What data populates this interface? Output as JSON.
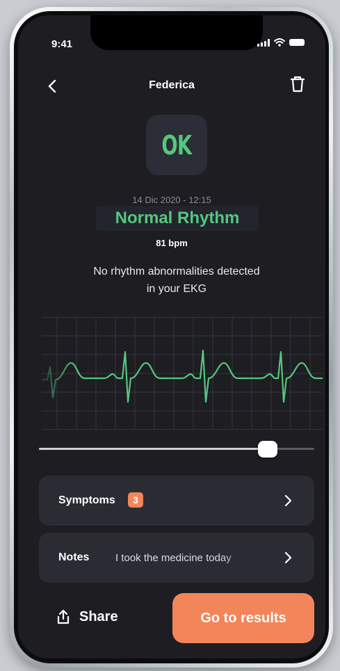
{
  "status_bar": {
    "time": "9:41"
  },
  "nav": {
    "title": "Federica",
    "back_icon": "chevron-left-icon",
    "delete_icon": "trash-icon"
  },
  "result": {
    "badge": "OK",
    "datetime": "14 Dic 2020 - 12:15",
    "rhythm": "Normal Rhythm",
    "bpm": "81 bpm",
    "message": "No rhythm abnormalities detected in your EKG"
  },
  "playback": {
    "position_fraction": 0.83
  },
  "cards": {
    "symptoms": {
      "label": "Symptoms",
      "count": "3"
    },
    "notes": {
      "label": "Notes",
      "text": "I took the medicine today"
    }
  },
  "actions": {
    "share_label": "Share",
    "results_label": "Go to results"
  },
  "colors": {
    "background": "#1d1d22",
    "card": "#2a2b33",
    "accent_green": "#55c77e",
    "accent_orange": "#f2855a",
    "muted_text": "#8b8e96"
  }
}
